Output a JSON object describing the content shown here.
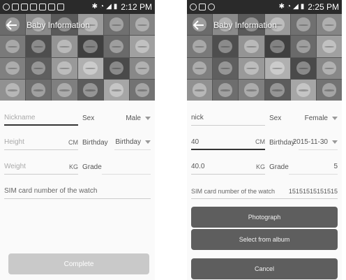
{
  "left_screen": {
    "status_bar": {
      "time": "2:12 PM"
    },
    "title": "Baby Information",
    "form": {
      "nickname": {
        "placeholder": "Nickname"
      },
      "sex": {
        "label": "Sex",
        "value": "Male"
      },
      "height": {
        "placeholder": "Height",
        "unit": "CM"
      },
      "birthday": {
        "label": "Birthday",
        "value": "Birthday"
      },
      "weight": {
        "placeholder": "Weight",
        "unit": "KG"
      },
      "grade": {
        "label": "Grade",
        "value": ""
      },
      "sim": {
        "placeholder": "SIM card number of the watch"
      }
    },
    "complete_label": "Complete"
  },
  "right_screen": {
    "status_bar": {
      "time": "2:25 PM"
    },
    "title": "Baby Information",
    "form": {
      "nickname": {
        "value": "nick"
      },
      "sex": {
        "label": "Sex",
        "value": "Female"
      },
      "height": {
        "value": "40",
        "unit": "CM"
      },
      "birthday": {
        "label": "Birthday",
        "value": "2015-11-30"
      },
      "weight": {
        "value": "40.0",
        "unit": "KG"
      },
      "grade": {
        "label": "Grade",
        "value": "5"
      },
      "sim": {
        "label": "SIM card number of the watch",
        "value": "15151515151515"
      }
    },
    "sheet": {
      "photograph": "Photograph",
      "select_album": "Select from album",
      "cancel": "Cancel"
    }
  },
  "icons": [
    "back-arrow-icon",
    "bluetooth-icon",
    "wifi-icon",
    "signal-icon",
    "battery-icon",
    "caret-down-icon"
  ],
  "colors": {
    "status_bar": "#2a2a2a",
    "sheet_button": "#5e5e5e",
    "complete_button": "#c9c9c9"
  }
}
